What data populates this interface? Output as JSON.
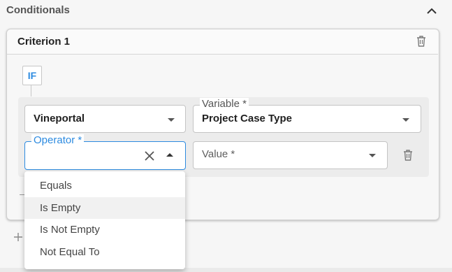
{
  "section": {
    "title": "Conditionals",
    "collapse_icon": "chevron-up-icon"
  },
  "criterion": {
    "title": "Criterion 1",
    "delete_icon": "trash-icon",
    "if_label": "IF",
    "source": {
      "value": "Vineportal"
    },
    "variable": {
      "label": "Variable *",
      "value": "Project Case Type"
    },
    "operator": {
      "label": "Operator *",
      "value": ""
    },
    "value_field": {
      "placeholder": "Value *"
    },
    "row_delete_icon": "trash-icon"
  },
  "dropdown": {
    "options": [
      "Equals",
      "Is Empty",
      "Is Not Empty",
      "Not Equal To"
    ],
    "highlighted_index": 1
  },
  "add_icon": "plus-icon",
  "colors": {
    "accent": "#2d8be0",
    "border": "#c4c4c4",
    "text": "#212121"
  }
}
